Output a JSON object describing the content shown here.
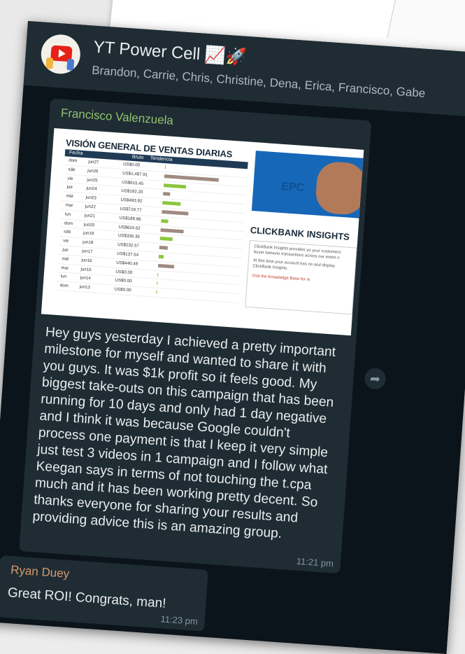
{
  "header": {
    "title": "YT Power Cell 📈🚀",
    "members": "Brandon, Carrie, Chris, Christine, Dena, Erica, Francisco, Gabe"
  },
  "messages": [
    {
      "sender": "Francisco Valenzuela",
      "text": "Hey guys yesterday I achieved a pretty important milestone for myself and wanted to share it with you guys. It was $1k profit so it feels good. My biggest take-outs on this campaign that has been running for 10 days and only had 1 day negative and I think it was because Google couldn't process one payment is that I keep it very simple just test 3 videos in 1 campaign and I follow what Keegan says in terms of not touching the t.cpa much and it has been working pretty decent. So thanks everyone for sharing your results and providing advice this is an amazing group.",
      "time": "11:21 pm"
    },
    {
      "sender": "Ryan Duey",
      "text": "Great ROI! Congrats, man!",
      "time": "11:23 pm"
    }
  ],
  "image": {
    "table_title": "VISIÓN GENERAL DE VENTAS DIARIAS",
    "col_fecha": "Fecha",
    "col_bruto": "Bruto",
    "col_tendencia": "Tendencia",
    "rows": [
      {
        "day": "dom",
        "date": "jun27",
        "val": "US$0.00",
        "bar": 0,
        "color": "#8cc63f"
      },
      {
        "day": "sáb",
        "date": "jun26",
        "val": "US$1,487.91",
        "bar": 1487.91,
        "color": "#a08a80"
      },
      {
        "day": "vie",
        "date": "jun25",
        "val": "US$615.45",
        "bar": 615.45,
        "color": "#8cc63f"
      },
      {
        "day": "jue",
        "date": "jun24",
        "val": "US$192.20",
        "bar": 192.2,
        "color": "#a08a80"
      },
      {
        "day": "mié",
        "date": "jun23",
        "val": "US$493.92",
        "bar": 493.92,
        "color": "#8cc63f"
      },
      {
        "day": "mar",
        "date": "jun22",
        "val": "US$719.77",
        "bar": 719.77,
        "color": "#a08a80"
      },
      {
        "day": "lun",
        "date": "jun21",
        "val": "US$189.86",
        "bar": 189.86,
        "color": "#8cc63f"
      },
      {
        "day": "dom",
        "date": "jun20",
        "val": "US$624.62",
        "bar": 624.62,
        "color": "#a08a80"
      },
      {
        "day": "sáb",
        "date": "jun19",
        "val": "US$336.36",
        "bar": 336.36,
        "color": "#8cc63f"
      },
      {
        "day": "vie",
        "date": "jun18",
        "val": "US$232.57",
        "bar": 232.57,
        "color": "#a08a80"
      },
      {
        "day": "jue",
        "date": "jun17",
        "val": "US$137.54",
        "bar": 137.54,
        "color": "#8cc63f"
      },
      {
        "day": "mié",
        "date": "jun16",
        "val": "US$440.49",
        "bar": 440.49,
        "color": "#a08a80"
      },
      {
        "day": "mar",
        "date": "jun15",
        "val": "US$0.00",
        "bar": 0,
        "color": "#8cc63f"
      },
      {
        "day": "lun",
        "date": "jun14",
        "val": "US$0.00",
        "bar": 0,
        "color": "#8cc63f"
      },
      {
        "day": "dom",
        "date": "jun13",
        "val": "US$0.00",
        "bar": 0,
        "color": "#8cc63f"
      }
    ],
    "epc_label": "EPC",
    "cb_title": "CLICKBANK INSIGHTS",
    "cb_text1": "ClickBank Insights provides yo your customers' buyer behavio transactions across our entire n",
    "cb_text2": "At this time your account has no and display ClickBank Insights.",
    "cb_link": "Visit the Knowledge Base for m"
  },
  "colors": {
    "sender1": "#91c26d",
    "sender2": "#d99a6c",
    "bubble": "#1f2c33",
    "chat_bg": "#0b141a"
  }
}
